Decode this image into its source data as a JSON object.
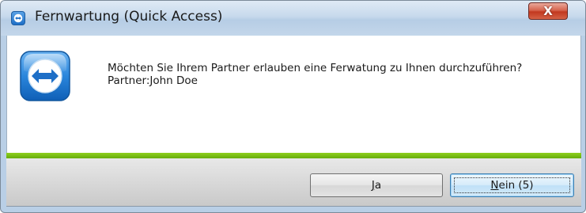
{
  "window": {
    "title": "Fernwartung (Quick Access)",
    "close_symbol": "X"
  },
  "message": {
    "question": "Möchten Sie Ihrem Partner erlauben eine Ferwatung zu Ihnen durchzuführen?",
    "partner": "Partner:John Doe"
  },
  "buttons": {
    "yes": {
      "accel": "J",
      "rest": "a"
    },
    "no": {
      "accel": "N",
      "rest": "ein (5)"
    }
  },
  "icons": {
    "title": "teamviewer-icon",
    "app": "teamviewer-logo-icon"
  },
  "colors": {
    "accent_bar": "#76bd12",
    "icon_blue": "#1e6fc7",
    "close_red": "#c2381f"
  }
}
